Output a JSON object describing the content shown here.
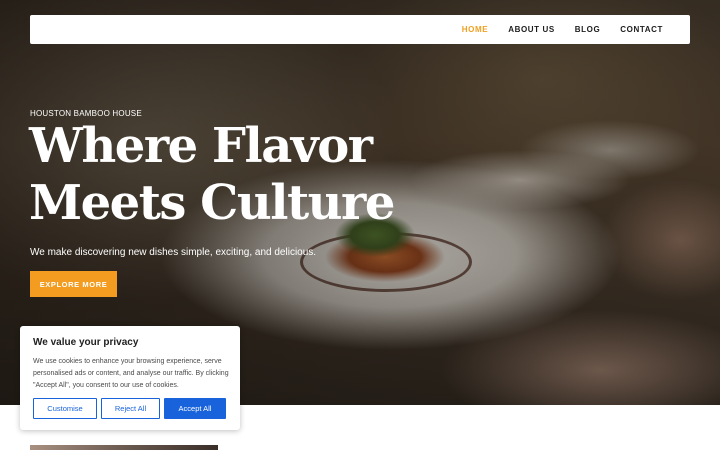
{
  "nav": {
    "items": [
      {
        "label": "HOME",
        "active": true
      },
      {
        "label": "ABOUT US",
        "active": false
      },
      {
        "label": "BLOG",
        "active": false
      },
      {
        "label": "CONTACT",
        "active": false
      }
    ],
    "active_color": "#f0a020"
  },
  "hero": {
    "eyebrow": "HOUSTON BAMBOO HOUSE",
    "headline_line1": "Where Flavor",
    "headline_line2": "Meets Culture",
    "subtitle": "We make discovering new dishes simple, exciting, and delicious.",
    "cta_label": "EXPLORE MORE",
    "cta_color": "#f39c1f"
  },
  "cookie_banner": {
    "title": "We value your privacy",
    "text": "We use cookies to enhance your browsing experience, serve personalised ads or content, and analyse our traffic. By clicking \"Accept All\", you consent to our use of cookies.",
    "customise_label": "Customise",
    "reject_label": "Reject All",
    "accept_label": "Accept All",
    "accent_color": "#1863dc"
  }
}
